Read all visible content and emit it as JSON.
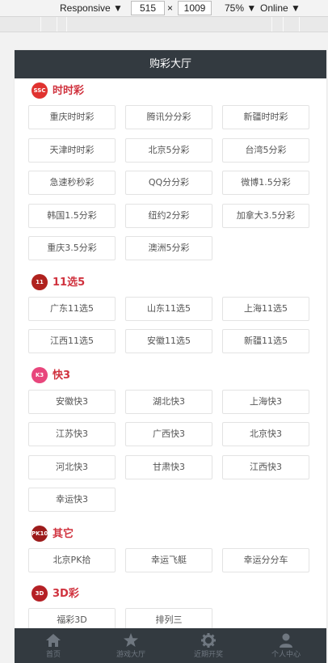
{
  "devtools": {
    "device": "Responsive",
    "width": "515",
    "times": "×",
    "height": "1009",
    "zoom": "75%",
    "network": "Online"
  },
  "header": {
    "title": "购彩大厅"
  },
  "sections": [
    {
      "title": "时时彩",
      "logo": {
        "text": "SSC",
        "color": "#e0322f"
      },
      "items": [
        "重庆时时彩",
        "腾讯分分彩",
        "新疆时时彩",
        "天津时时彩",
        "北京5分彩",
        "台湾5分彩",
        "急速秒秒彩",
        "QQ分分彩",
        "微博1.5分彩",
        "韩国1.5分彩",
        "纽约2分彩",
        "加拿大3.5分彩",
        "重庆3.5分彩",
        "澳洲5分彩"
      ]
    },
    {
      "title": "11选5",
      "logo": {
        "text": "11",
        "color": "#b0221e"
      },
      "items": [
        "广东11选5",
        "山东11选5",
        "上海11选5",
        "江西11选5",
        "安徽11选5",
        "新疆11选5"
      ]
    },
    {
      "title": "快3",
      "logo": {
        "text": "K3",
        "color": "#e8467c"
      },
      "items": [
        "安徽快3",
        "湖北快3",
        "上海快3",
        "江苏快3",
        "广西快3",
        "北京快3",
        "河北快3",
        "甘肃快3",
        "江西快3",
        "幸运快3"
      ]
    },
    {
      "title": "其它",
      "logo": {
        "text": "PK10",
        "color": "#9c1b1b"
      },
      "items": [
        "北京PK拾",
        "幸运飞艇",
        "幸运分分车"
      ]
    },
    {
      "title": "3D彩",
      "logo": {
        "text": "3D",
        "color": "#b52025"
      },
      "items": [
        "福彩3D",
        "排列三"
      ]
    }
  ],
  "tabbar": {
    "items": [
      {
        "label": "首页",
        "icon": "home-icon"
      },
      {
        "label": "游戏大厅",
        "icon": "star-icon"
      },
      {
        "label": "近期开奖",
        "icon": "gear-icon"
      },
      {
        "label": "个人中心",
        "icon": "user-icon"
      }
    ]
  }
}
